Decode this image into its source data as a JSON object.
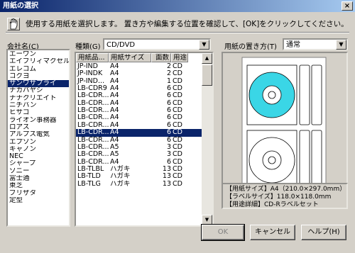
{
  "window": {
    "title": "用紙の選択",
    "close_glyph": "×"
  },
  "instruction": "使用する用紙を選択します。 置き方や編集する位置を確認して、[OK]をクリックしてください。",
  "company": {
    "label": "会社名(C)",
    "items": [
      "エーワン",
      "エイブリィマクセル",
      "エレコム",
      "コクヨ",
      "サンワサプライ",
      "ナカバヤシ",
      "ナナクリエイト",
      "ニチバン",
      "ヒサゴ",
      "ライオン事務器",
      "ロアス",
      "アルプス電気",
      "エプソン",
      "キャノン",
      "NEC",
      "シャープ",
      "ソニー",
      "富士通",
      "東芝",
      "ブリザタ",
      "定型"
    ],
    "selected_index": 4
  },
  "kind": {
    "label": "種類(G)",
    "value": "CD/DVD"
  },
  "paper_table": {
    "headers": [
      "用紙品...",
      "用紙サイズ",
      "面数",
      "用途"
    ],
    "rows": [
      [
        "JP-IND",
        "A4",
        "2",
        "CD"
      ],
      [
        "JP-INDK",
        "A4",
        "2",
        "CD"
      ],
      [
        "JP-IND...",
        "A4",
        "1",
        "CD"
      ],
      [
        "LB-CDR9",
        "A4",
        "6",
        "CD"
      ],
      [
        "LB-CDR...",
        "A4",
        "6",
        "CD"
      ],
      [
        "LB-CDR...",
        "A4",
        "6",
        "CD"
      ],
      [
        "LB-CDR...",
        "A4",
        "6",
        "CD"
      ],
      [
        "LB-CDR...",
        "A4",
        "6",
        "CD"
      ],
      [
        "LB-CDR...",
        "A4",
        "6",
        "CD"
      ],
      [
        "LB-CDR...",
        "A4",
        "6",
        "CD"
      ],
      [
        "LB-CDR...",
        "A4",
        "6",
        "CD"
      ],
      [
        "LB-CDR...",
        "A5",
        "3",
        "CD"
      ],
      [
        "LB-CDR...",
        "A5",
        "3",
        "CD"
      ],
      [
        "LB-CDR...",
        "A4",
        "6",
        "CD"
      ],
      [
        "LB-TLBL",
        "ハガキ",
        "13",
        "CD"
      ],
      [
        "LB-TLD",
        "ハガキ",
        "13",
        "CD"
      ],
      [
        "LB-TLG",
        "ハガキ",
        "13",
        "CD"
      ]
    ],
    "selected_index": 9
  },
  "placement": {
    "label": "用紙の置き方(T)",
    "value": "通常"
  },
  "info": {
    "line1": "【用紙サイズ】A4（210.0×297.0mm）",
    "line2": "【ラベルサイズ】118.0×118.0mm",
    "line3": "【用途詳細】CD-Rラベルセット"
  },
  "buttons": {
    "ok": "OK",
    "cancel": "キャンセル",
    "help": "ヘルプ(H)"
  },
  "colors": {
    "accent": "#3ad6e6",
    "selection": "#0a246a"
  }
}
